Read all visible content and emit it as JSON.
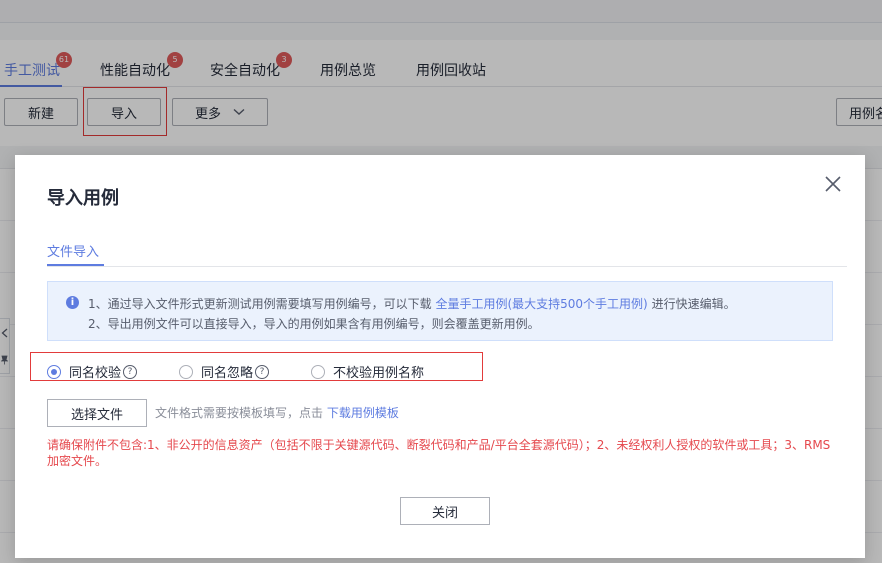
{
  "tabs": [
    {
      "label": "手工测试",
      "badge": "61",
      "active": true
    },
    {
      "label": "性能自动化",
      "badge": "5"
    },
    {
      "label": "安全自动化",
      "badge": "3"
    },
    {
      "label": "用例总览"
    },
    {
      "label": "用例回收站"
    }
  ],
  "toolbar": {
    "new_label": "新建",
    "import_label": "导入",
    "more_label": "更多",
    "search_label": "用例名"
  },
  "modal": {
    "title": "导入用例",
    "tab_label": "文件导入",
    "info": {
      "line1_prefix": "1、通过导入文件形式更新测试用例需要填写用例编号，可以下载",
      "line1_link": "全量手工用例(最大支持500个手工用例)",
      "line1_suffix": "进行快速编辑。",
      "line2": "2、导出用例文件可以直接导入，导入的用例如果含有用例编号，则会覆盖更新用例。"
    },
    "options": [
      {
        "label": "同名校验",
        "checked": true,
        "help": "?"
      },
      {
        "label": "同名忽略",
        "checked": false,
        "help": "?"
      },
      {
        "label": "不校验用例名称",
        "checked": false
      }
    ],
    "file_button": "选择文件",
    "file_hint": "文件格式需要按模板填写，点击",
    "template_link": "下载用例模板",
    "warning": "请确保附件不包含:1、非公开的信息资产（包括不限于关键源代码、断裂代码和产品/平台全套源代码）；2、未经权利人授权的软件或工具；3、RMS加密文件。",
    "close_button": "关闭"
  },
  "colors": {
    "accent": "#5e7ce0",
    "badge": "#e05a5a",
    "warning": "#e5484d",
    "highlight": "#e23b3b"
  }
}
